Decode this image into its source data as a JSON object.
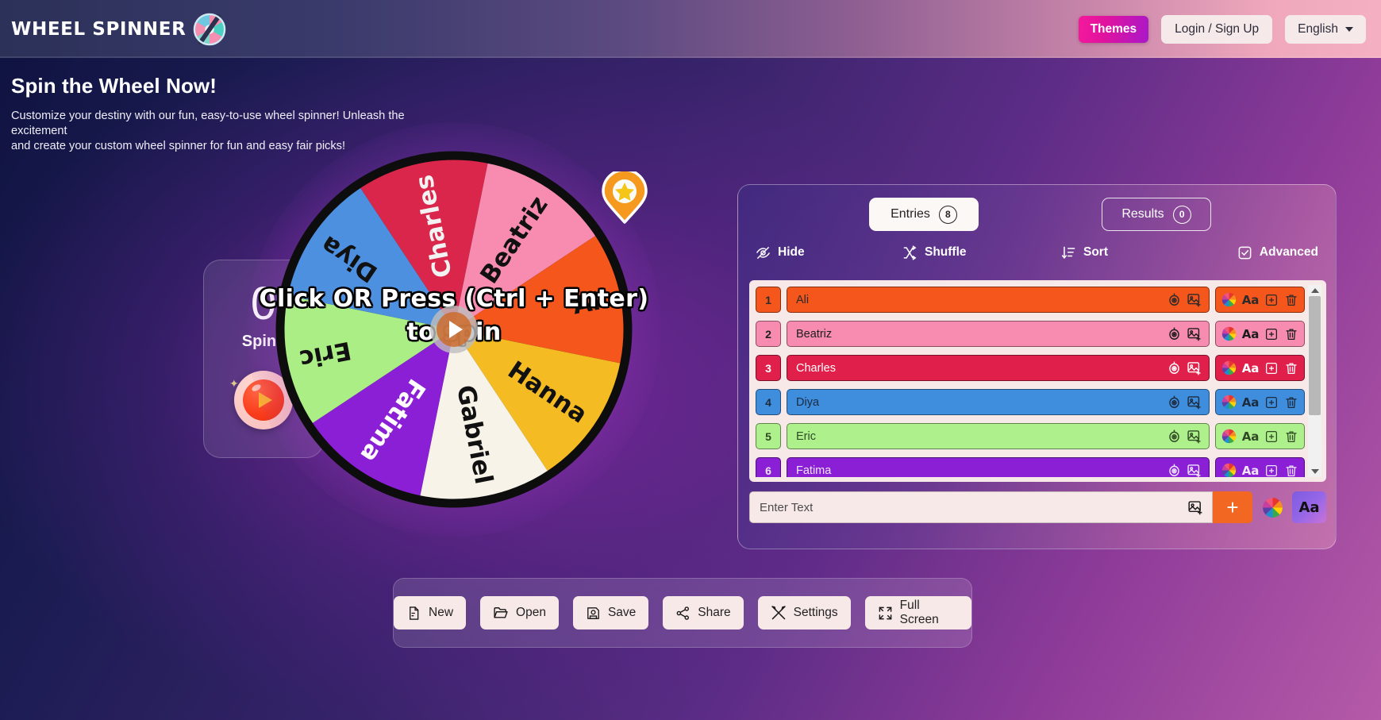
{
  "header": {
    "brand": "WHEEL SPINNER",
    "logo_icon": "wheel-logo-icon",
    "themes_label": "Themes",
    "login_label": "Login / Sign Up",
    "language_label": "English"
  },
  "hero": {
    "title": "Spin the Wheel Now!",
    "subtitle_line1": "Customize your destiny with our fun, easy-to-use wheel spinner! Unleash the excitement",
    "subtitle_line2": "and create your custom wheel spinner for fun and easy fair picks!"
  },
  "spin_panel": {
    "count": "0",
    "label": "Spins",
    "play_icon": "play-icon"
  },
  "wheel": {
    "cta_line1": "Click OR Press (Ctrl + Enter)",
    "cta_line2": "to spin",
    "hub_icon": "play-icon",
    "pointer_icon": "map-pin-star-icon",
    "segments": [
      {
        "label": "Charles",
        "color": "#d9264a",
        "text_color": "#f2f2f2"
      },
      {
        "label": "Beatriz",
        "color": "#f78cb0",
        "text_color": "#111111"
      },
      {
        "label": "Ali",
        "color": "#f4561c",
        "text_color": "#111111"
      },
      {
        "label": "Hanna",
        "color": "#f5bb22",
        "text_color": "#111111"
      },
      {
        "label": "Gabriel",
        "color": "#f7f3e8",
        "text_color": "#111111"
      },
      {
        "label": "Fatima",
        "color": "#8b1fd6",
        "text_color": "#ffffff"
      },
      {
        "label": "Eric",
        "color": "#aaee85",
        "text_color": "#111111"
      },
      {
        "label": "Diya",
        "color": "#4d90e0",
        "text_color": "#111111"
      }
    ]
  },
  "entries_panel": {
    "tab_entries_label": "Entries",
    "tab_entries_count": "8",
    "tab_results_label": "Results",
    "tab_results_count": "0",
    "toolbar": {
      "hide_label": "Hide",
      "hide_icon": "eye-slash-icon",
      "shuffle_label": "Shuffle",
      "shuffle_icon": "shuffle-icon",
      "sort_label": "Sort",
      "sort_icon": "sort-descending-icon",
      "advanced_label": "Advanced",
      "advanced_icon": "checkbox-checked-icon"
    },
    "row_icons": {
      "visibility": "eye-target-icon",
      "image": "add-image-icon",
      "color": "color-wheel-icon",
      "font": "Aa",
      "duplicate": "duplicate-icon",
      "delete": "trash-icon"
    },
    "rows": [
      {
        "num": "1",
        "text": "Ali",
        "color": "#f4561c",
        "text_color": "#2b2b2b"
      },
      {
        "num": "2",
        "text": "Beatriz",
        "color": "#f78cb0",
        "text_color": "#1d1d1d"
      },
      {
        "num": "3",
        "text": "Charles",
        "color": "#e01f4b",
        "text_color": "#ffffff"
      },
      {
        "num": "4",
        "text": "Diya",
        "color": "#3f8ddd",
        "text_color": "#1d2b3d"
      },
      {
        "num": "5",
        "text": "Eric",
        "color": "#aef08c",
        "text_color": "#2f4a25"
      },
      {
        "num": "6",
        "text": "Fatima",
        "color": "#8b1fd6",
        "text_color": "#f0e6fa"
      }
    ],
    "add_bar": {
      "placeholder": "Enter Text",
      "image_icon": "add-image-icon",
      "add_icon": "plus-icon",
      "color_icon": "color-wheel-icon",
      "font_label": "Aa"
    }
  },
  "bottom_toolbar": {
    "buttons": [
      {
        "label": "New",
        "icon": "file-new-icon"
      },
      {
        "label": "Open",
        "icon": "folder-open-icon"
      },
      {
        "label": "Save",
        "icon": "floppy-save-icon"
      },
      {
        "label": "Share",
        "icon": "share-nodes-icon"
      },
      {
        "label": "Settings",
        "icon": "tools-icon"
      },
      {
        "label": "Full Screen",
        "icon": "expand-icon"
      }
    ]
  },
  "colors": {
    "accent_pink": "#f5199c",
    "accent_orange": "#f26722",
    "panel_cream": "#f7e9e8"
  }
}
